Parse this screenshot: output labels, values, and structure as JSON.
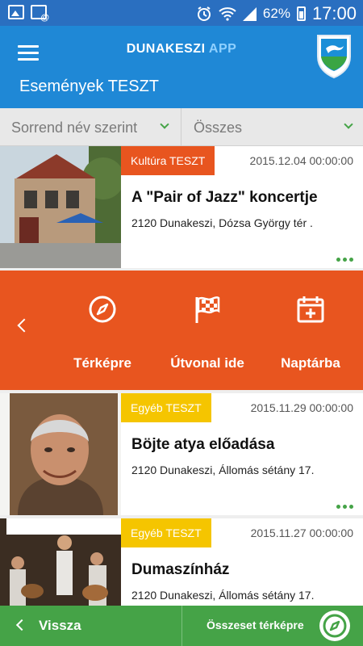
{
  "status_bar": {
    "battery": "62%",
    "time": "17:00"
  },
  "app": {
    "brand_main": "DUNAKESZI",
    "brand_accent": "APP",
    "page_title": "Események TESZT"
  },
  "filters": {
    "sort_label": "Sorrend név szerint",
    "category_label": "Összes"
  },
  "events": [
    {
      "category": "Kultúra TESZT",
      "category_color": "#e8551f",
      "date": "2015.12.04 00:00:00",
      "title": "A \"Pair of Jazz\" koncertje",
      "address": "2120 Dunakeszi, Dózsa György tér ."
    },
    {
      "category": "Egyéb TESZT",
      "category_color": "#f5c500",
      "date": "2015.11.29 00:00:00",
      "title": "Böjte atya előadása",
      "address": "2120 Dunakeszi, Állomás sétány 17."
    },
    {
      "category": "Egyéb TESZT",
      "category_color": "#f5c500",
      "date": "2015.11.27 00:00:00",
      "title": "Dumaszínház",
      "address": "2120 Dunakeszi, Állomás sétány 17."
    }
  ],
  "actions": {
    "map_label": "Térképre",
    "route_label": "Útvonal ide",
    "calendar_label": "Naptárba"
  },
  "bottom_bar": {
    "back_label": "Vissza",
    "all_on_map_label": "Összeset térképre"
  },
  "colors": {
    "status_bar": "#2a6fc0",
    "header": "#1f88d6",
    "accent_orange": "#e8551f",
    "accent_green": "#45a347",
    "category_yellow": "#f5c500"
  }
}
